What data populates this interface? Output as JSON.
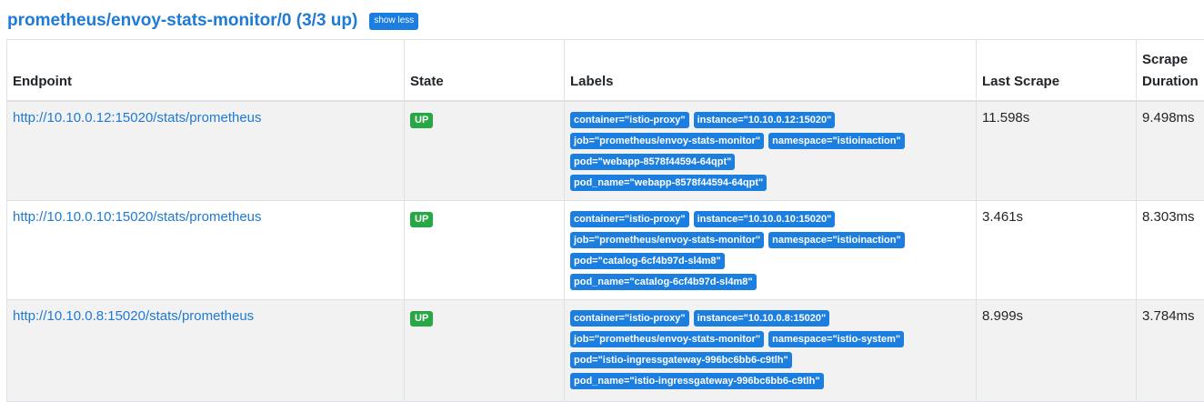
{
  "pool": {
    "title": "prometheus/envoy-stats-monitor/0 (3/3 up)",
    "toggle_label": "show less"
  },
  "table": {
    "headers": {
      "endpoint": "Endpoint",
      "state": "State",
      "labels": "Labels",
      "last_scrape": "Last Scrape",
      "scrape_duration_line1": "Scrape",
      "scrape_duration_line2": "Duration"
    },
    "rows": [
      {
        "endpoint": "http://10.10.0.12:15020/stats/prometheus",
        "state": "UP",
        "labels": [
          [
            "container=\"istio-proxy\"",
            "instance=\"10.10.0.12:15020\""
          ],
          [
            "job=\"prometheus/envoy-stats-monitor\"",
            "namespace=\"istioinaction\""
          ],
          [
            "pod=\"webapp-8578f44594-64qpt\""
          ],
          [
            "pod_name=\"webapp-8578f44594-64qpt\""
          ]
        ],
        "last_scrape": "11.598s",
        "scrape_duration": "9.498ms"
      },
      {
        "endpoint": "http://10.10.0.10:15020/stats/prometheus",
        "state": "UP",
        "labels": [
          [
            "container=\"istio-proxy\"",
            "instance=\"10.10.0.10:15020\""
          ],
          [
            "job=\"prometheus/envoy-stats-monitor\"",
            "namespace=\"istioinaction\""
          ],
          [
            "pod=\"catalog-6cf4b97d-sl4m8\""
          ],
          [
            "pod_name=\"catalog-6cf4b97d-sl4m8\""
          ]
        ],
        "last_scrape": "3.461s",
        "scrape_duration": "8.303ms"
      },
      {
        "endpoint": "http://10.10.0.8:15020/stats/prometheus",
        "state": "UP",
        "labels": [
          [
            "container=\"istio-proxy\"",
            "instance=\"10.10.0.8:15020\""
          ],
          [
            "job=\"prometheus/envoy-stats-monitor\"",
            "namespace=\"istio-system\""
          ],
          [
            "pod=\"istio-ingressgateway-996bc6bb6-c9tlh\""
          ],
          [
            "pod_name=\"istio-ingressgateway-996bc6bb6-c9tlh\""
          ]
        ],
        "last_scrape": "8.999s",
        "scrape_duration": "3.784ms"
      }
    ]
  },
  "colors": {
    "link": "#1e7ad6",
    "badge_blue": "#1c7fe0",
    "badge_green": "#28a745",
    "stripe": "#f2f2f2"
  }
}
